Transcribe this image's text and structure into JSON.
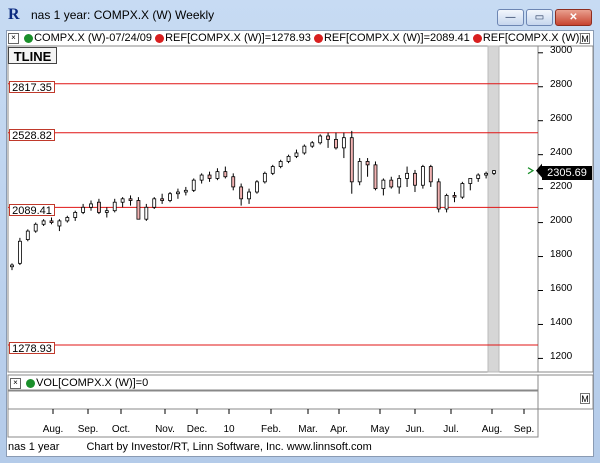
{
  "window": {
    "title": "nas 1 year: COMPX.X (W) Weekly",
    "min_glyph": "—",
    "max_glyph": "▭",
    "close_glyph": "✕",
    "app_icon": "R"
  },
  "legend": {
    "close_glyph": "×",
    "items": [
      {
        "label": "COMPX.X (W)-07/24/09",
        "color": "#1a8f2a"
      },
      {
        "label": "REF[COMPX.X (W)]=1278.93",
        "color": "#d81f1f"
      },
      {
        "label": "REF[COMPX.X (W)]=2089.41",
        "color": "#d81f1f"
      },
      {
        "label": "REF[COMPX.X (W)]",
        "color": "#d81f1f"
      }
    ]
  },
  "tline_label": "TLINE",
  "last_price": "2305.69",
  "m_box": "M",
  "volume_legend": {
    "close_glyph": "×",
    "label": "VOL[COMPX.X (W)]=0",
    "color": "#1a8f2a"
  },
  "footer": {
    "left": "nas 1 year",
    "right": "Chart by Investor/RT, Linn Software, Inc. www.linnsoft.com"
  },
  "colors": {
    "up": "#ffffff",
    "down": "#f2b3b3",
    "ref_line": "#e01414",
    "highlight": "#d6d6d6"
  },
  "chart_data": {
    "type": "candlestick",
    "ylim": [
      1120,
      3040
    ],
    "yticks": [
      1200,
      1400,
      1600,
      1800,
      2000,
      2200,
      2400,
      2600,
      2800,
      3000
    ],
    "ref_lines": [
      2817.35,
      2528.82,
      2089.41,
      1278.93
    ],
    "x_labels": [
      "Aug.",
      "Sep.",
      "Oct.",
      "Nov.",
      "Dec.",
      "10",
      "Feb.",
      "Mar.",
      "Apr.",
      "May",
      "Jun.",
      "Jul.",
      "Aug.",
      "Sep."
    ],
    "candles": [
      [
        1740,
        1760,
        1720,
        1750
      ],
      [
        1760,
        1910,
        1750,
        1890
      ],
      [
        1900,
        1960,
        1890,
        1950
      ],
      [
        1950,
        2000,
        1940,
        1990
      ],
      [
        1990,
        2020,
        1980,
        2010
      ],
      [
        2010,
        2030,
        1990,
        2000
      ],
      [
        1980,
        2020,
        1950,
        2010
      ],
      [
        2010,
        2040,
        2000,
        2030
      ],
      [
        2030,
        2070,
        2010,
        2060
      ],
      [
        2060,
        2110,
        2050,
        2090
      ],
      [
        2090,
        2130,
        2070,
        2110
      ],
      [
        2120,
        2140,
        2050,
        2060
      ],
      [
        2060,
        2090,
        2030,
        2070
      ],
      [
        2070,
        2140,
        2060,
        2120
      ],
      [
        2120,
        2150,
        2090,
        2140
      ],
      [
        2140,
        2160,
        2100,
        2130
      ],
      [
        2130,
        2150,
        2020,
        2020
      ],
      [
        2020,
        2110,
        2010,
        2090
      ],
      [
        2090,
        2150,
        2080,
        2140
      ],
      [
        2140,
        2170,
        2110,
        2130
      ],
      [
        2130,
        2180,
        2120,
        2170
      ],
      [
        2170,
        2200,
        2140,
        2180
      ],
      [
        2180,
        2210,
        2160,
        2190
      ],
      [
        2190,
        2260,
        2180,
        2250
      ],
      [
        2250,
        2290,
        2230,
        2280
      ],
      [
        2280,
        2300,
        2240,
        2260
      ],
      [
        2260,
        2320,
        2250,
        2300
      ],
      [
        2300,
        2330,
        2260,
        2270
      ],
      [
        2270,
        2290,
        2190,
        2210
      ],
      [
        2210,
        2230,
        2100,
        2140
      ],
      [
        2140,
        2200,
        2110,
        2180
      ],
      [
        2180,
        2250,
        2170,
        2240
      ],
      [
        2240,
        2300,
        2230,
        2290
      ],
      [
        2290,
        2340,
        2280,
        2330
      ],
      [
        2330,
        2370,
        2320,
        2360
      ],
      [
        2360,
        2400,
        2350,
        2390
      ],
      [
        2390,
        2430,
        2380,
        2410
      ],
      [
        2410,
        2460,
        2400,
        2450
      ],
      [
        2450,
        2480,
        2440,
        2470
      ],
      [
        2470,
        2520,
        2460,
        2510
      ],
      [
        2510,
        2530,
        2440,
        2490
      ],
      [
        2490,
        2530,
        2430,
        2440
      ],
      [
        2440,
        2530,
        2380,
        2500
      ],
      [
        2500,
        2540,
        2170,
        2240
      ],
      [
        2240,
        2380,
        2220,
        2360
      ],
      [
        2360,
        2380,
        2270,
        2340
      ],
      [
        2340,
        2360,
        2190,
        2200
      ],
      [
        2200,
        2260,
        2160,
        2250
      ],
      [
        2250,
        2270,
        2200,
        2210
      ],
      [
        2210,
        2280,
        2170,
        2260
      ],
      [
        2260,
        2330,
        2210,
        2290
      ],
      [
        2290,
        2310,
        2180,
        2220
      ],
      [
        2220,
        2340,
        2200,
        2330
      ],
      [
        2330,
        2340,
        2210,
        2240
      ],
      [
        2240,
        2260,
        2060,
        2080
      ],
      [
        2080,
        2170,
        2060,
        2160
      ],
      [
        2160,
        2180,
        2120,
        2150
      ],
      [
        2150,
        2240,
        2140,
        2230
      ],
      [
        2230,
        2260,
        2190,
        2260
      ],
      [
        2260,
        2290,
        2240,
        2280
      ],
      [
        2280,
        2300,
        2260,
        2290
      ],
      [
        2290,
        2310,
        2280,
        2305.69
      ]
    ]
  }
}
